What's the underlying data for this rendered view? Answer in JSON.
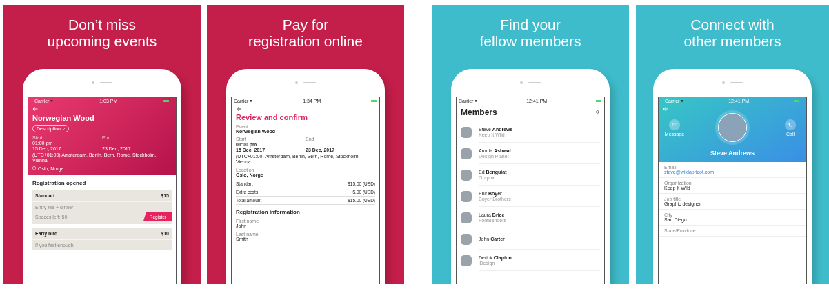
{
  "panels": [
    {
      "kind": "event",
      "color": "#c41e4a",
      "heading": "Don’t miss\nupcoming events",
      "status": {
        "carrier": "Carrier",
        "time": "1:03 PM"
      },
      "event": {
        "title": "Norwegian Wood",
        "chip": "Description",
        "start_label": "Start",
        "end_label": "End",
        "start_time": "01:00 pm",
        "start_date": "15 Dec, 2017",
        "end_date": "23 Dec, 2017",
        "timezone": "(UTC+01:00) Amsterdam, Berlin, Bern, Rome, Stockholm, Vienna",
        "location": "Oslo, Norge"
      },
      "section": "Registration opened",
      "tickets": [
        {
          "name": "Standart",
          "price": "$15",
          "description": "Entry fee + dinner",
          "spaces": "Spaces left: 50",
          "button": "Register"
        },
        {
          "name": "Early bird",
          "price": "$10",
          "description": "If you fast enough"
        }
      ]
    },
    {
      "kind": "review",
      "color": "#c41e4a",
      "heading": "Pay for\nregistration online",
      "status": {
        "carrier": "Carrier",
        "time": "1:34 PM"
      },
      "title": "Review and confirm",
      "event": {
        "label": "Event",
        "value": "Norwegian Wood"
      },
      "dates": {
        "start_label": "Start",
        "end_label": "End",
        "start_time": "01:00 pm",
        "start_date": "15 Dec, 2017",
        "end_date": "23 Dec, 2017",
        "timezone": "(UTC+01:00) Amsterdam, Berlin, Bern, Rome, Stockholm, Vienna"
      },
      "location": {
        "label": "Location",
        "value": "Oslo, Norge"
      },
      "costs": [
        {
          "label": "Standart",
          "amount": "$15.00 (USD)"
        },
        {
          "label": "Extra costs",
          "amount": "$.00 (USD)"
        },
        {
          "label": "Total amount",
          "amount": "$15.00 (USD)"
        }
      ],
      "section": "Registration information",
      "form": [
        {
          "label": "First name",
          "value": "John"
        },
        {
          "label": "Last name",
          "value": "Smith"
        }
      ]
    },
    {
      "kind": "members",
      "color": "#3fbccb",
      "heading": "Find your\nfellow members",
      "status": {
        "carrier": "Carrier",
        "time": "12:41 PM"
      },
      "title": "Members",
      "members": [
        {
          "name": "Steve **Andrews**",
          "org": "Keep It Wild"
        },
        {
          "name": "Amrita **Ashwal**",
          "org": "Design Planet"
        },
        {
          "name": "Ed **Benguiat**",
          "org": "Graphx"
        },
        {
          "name": "Eric **Boyer**",
          "org": "Boyer Brothers"
        },
        {
          "name": "Laura **Brice**",
          "org": "FontBenders"
        },
        {
          "name": "John **Carter**"
        },
        {
          "name": "Derick **Clapton**",
          "org": "iDesign"
        }
      ]
    },
    {
      "kind": "profile",
      "color": "#3fbccb",
      "heading": "Connect with\nother members",
      "status": {
        "carrier": "Carrier",
        "time": "12:41 PM"
      },
      "message_label": "Message",
      "call_label": "Call",
      "name": "Steve Andrews",
      "fields": [
        {
          "kind": "link",
          "label": "Email",
          "value": "steve@wildapricot.com"
        },
        {
          "kind": "text",
          "label": "Organization",
          "value": "Keep It Wild"
        },
        {
          "kind": "text",
          "label": "Job title",
          "value": "Graphic designer"
        },
        {
          "kind": "text",
          "label": "City",
          "value": "San Diego"
        },
        {
          "kind": "text",
          "label": "State/Province"
        }
      ]
    }
  ]
}
